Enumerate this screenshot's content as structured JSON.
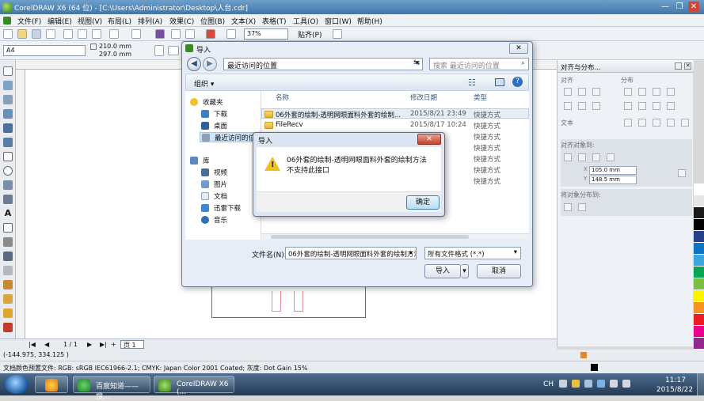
{
  "window": {
    "title": "CorelDRAW X6 (64 位) - [C:\\Users\\Administrator\\Desktop\\人台.cdr]",
    "min": "—",
    "max": "❐",
    "close": "✕"
  },
  "menu": [
    "文件(F)",
    "编辑(E)",
    "视图(V)",
    "布局(L)",
    "排列(A)",
    "效果(C)",
    "位图(B)",
    "文本(X)",
    "表格(T)",
    "工具(O)",
    "窗口(W)",
    "帮助(H)"
  ],
  "toolbar": {
    "zoom": "37%",
    "snap": "贴齐(P)",
    "paper": "A4",
    "width": "210.0 mm",
    "height": "297.0 mm"
  },
  "docker": {
    "title": "对齐与分布...",
    "align": "对齐",
    "distribute": "分布",
    "text": "文本",
    "align_to": "对齐对象到:",
    "x_value": "105.0 mm",
    "y_value": "148.5 mm",
    "x_label": "X",
    "y_label": "Y",
    "distribute_to": "将对象分布到:"
  },
  "pagebar": {
    "pages": "1 / 1",
    "page_tab": "页 1"
  },
  "status": {
    "coords": "(-144.975, 334.125 )",
    "profile": "文档颜色预置文件: RGB: sRGB IEC61966-2.1; CMYK: Japan Color 2001 Coated; 灰度: Dot Gain 15%"
  },
  "import_dialog": {
    "title": "导入",
    "address": "最近访问的位置",
    "search_placeholder": "搜索 最近访问的位置",
    "organize": "组织 ▾",
    "nav": {
      "favorites": "收藏夹",
      "downloads": "下载",
      "desktop": "桌面",
      "recent": "最近访问的位置",
      "library": "库",
      "video": "视频",
      "pictures": "图片",
      "documents": "文档",
      "xunlei": "迅雷下载",
      "music": "音乐"
    },
    "columns": {
      "name": "名称",
      "date": "修改日期",
      "type": "类型"
    },
    "rows": [
      {
        "name": "06外套的绘制-透明网眼面料外套的绘制...",
        "date": "2015/8/21 23:49",
        "type": "快捷方式"
      },
      {
        "name": "FileRecv",
        "date": "2015/8/17 10:24",
        "type": "快捷方式"
      },
      {
        "name": "",
        "date": ":20",
        "type": "快捷方式"
      },
      {
        "name": "",
        "date": ":19",
        "type": "快捷方式"
      },
      {
        "name": "",
        "date": ":48",
        "type": "快捷方式"
      },
      {
        "name": "",
        "date": ":18",
        "type": "快捷方式"
      },
      {
        "name": "",
        "date": ":52",
        "type": "快捷方式"
      }
    ],
    "filename_label": "文件名(N):",
    "filename_value": "06外套的绘制-透明网眼面料外套的绘制方法",
    "filetype_value": "所有文件格式 (*.*)",
    "import_button": "导入",
    "cancel_button": "取消"
  },
  "error_dialog": {
    "title": "导入",
    "line1": "06外套的绘制-透明网眼面料外套的绘制方法",
    "line2": "不支持此接口",
    "ok": "确定"
  },
  "taskbar": {
    "task1": "百度知道——搜...",
    "task2": "CorelDRAW X6 (...",
    "lang": "CH",
    "time": "11:17",
    "date": "2015/8/22"
  },
  "colors": {
    "palette": [
      "#ffffff",
      "#e6e6e6",
      "#1a1a1a",
      "#000000",
      "#27408b",
      "#0e72c5",
      "#3aa7e0",
      "#00a651",
      "#7ac143",
      "#fff200",
      "#f7941d",
      "#ed1c24",
      "#ec008c",
      "#92278f",
      "#c49a6c",
      "#a8a8a8"
    ]
  }
}
